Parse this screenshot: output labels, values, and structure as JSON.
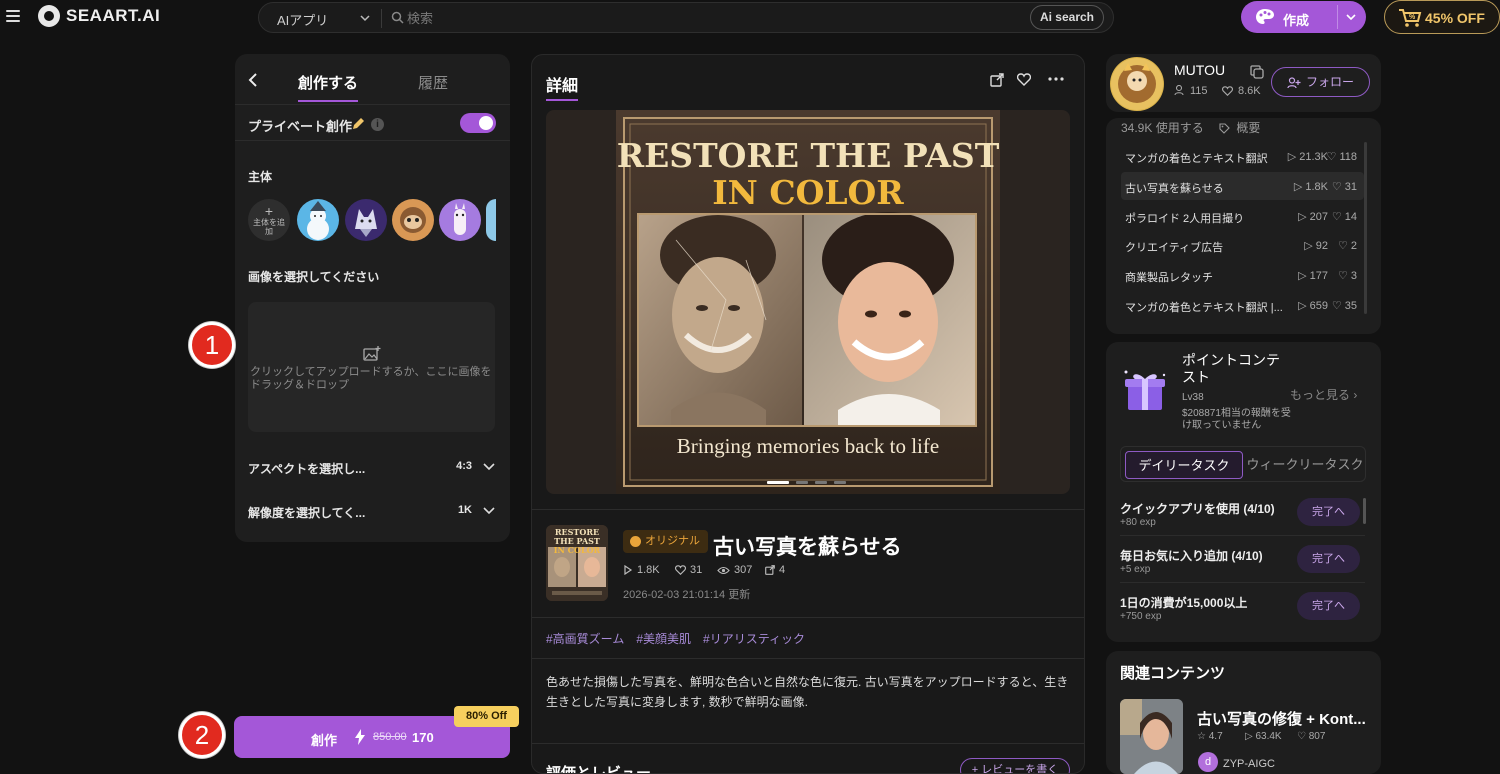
{
  "topbar": {
    "logo_text": "SEAART.AI",
    "search_category": "AIアプリ",
    "search_placeholder": "検索",
    "ai_search_label": "Ai search",
    "create_label": "作成",
    "discount_label": "45% OFF"
  },
  "left_panel": {
    "tab_create": "創作する",
    "tab_history": "履歴",
    "private_label": "プライベート創作",
    "private_enabled": true,
    "subject_title": "主体",
    "add_subject_plus": "+",
    "add_subject_label": "主体を追加",
    "image_title": "画像を選択してください",
    "upload_hint": "クリックしてアップロードするか、ここに画像をドラッグ＆ドロップ",
    "aspect_label": "アスペクトを選択し...",
    "aspect_value": "4:3",
    "resolution_label": "解像度を選択してく...",
    "resolution_value": "1K"
  },
  "generate": {
    "label": "創作",
    "old_price": "850.00",
    "new_price": "170",
    "badge": "80% Off"
  },
  "steps": [
    "1",
    "2"
  ],
  "detail": {
    "heading": "詳細",
    "hero_title_line1": "RESTORE THE PAST",
    "hero_title_line2": "IN COLOR",
    "hero_subtitle": "Bringing memories back to life",
    "thumb_title_line1": "RESTORE THE PAST",
    "thumb_title_line2": "IN COLOR",
    "original_badge": "オリジナル",
    "app_title": "古い写真を蘇らせる",
    "runs": "1.8K",
    "likes": "31",
    "views": "307",
    "shares": "4",
    "updated": "2026-02-03 21:01:14 更新",
    "tags": [
      "#高画質ズーム",
      "#美顔美肌",
      "#リアリスティック"
    ],
    "description": "色あせた損傷した写真を、鮮明な色合いと自然な色に復元. 古い写真をアップロードすると、生き生きとした写真に変身します, 数秒で鮮明な画像.",
    "reviews_title": "評価とレビュー",
    "write_review": "+ レビューを書く"
  },
  "profile": {
    "name": "MUTOU",
    "followers": "115",
    "likes": "8.6K",
    "follow_label": "フォロー",
    "usage": "34.9K 使用する",
    "overview": "概要"
  },
  "app_list": [
    {
      "name": "マンガの着色とテキスト翻訳",
      "runs": "21.3K",
      "likes": "118"
    },
    {
      "name": "古い写真を蘇らせる",
      "runs": "1.8K",
      "likes": "31"
    },
    {
      "name": "ポラロイド 2人用目撮り",
      "runs": "207",
      "likes": "14"
    },
    {
      "name": "クリエイティブ広告",
      "runs": "92",
      "likes": "2"
    },
    {
      "name": "商業製品レタッチ",
      "runs": "177",
      "likes": "3"
    },
    {
      "name": "マンガの着色とテキスト翻訳 |...",
      "runs": "659",
      "likes": "35"
    }
  ],
  "contest": {
    "title": "ポイントコンテスト",
    "more": "もっと見る",
    "level": "Lv38",
    "reward": "$208871相当の報酬を受け取っていません",
    "tab_daily": "デイリータスク",
    "tab_weekly": "ウィークリータスク",
    "tasks": [
      {
        "name": "クイックアプリを使用 (4/10)",
        "exp": "+80 exp",
        "button": "完了へ"
      },
      {
        "name": "毎日お気に入り追加 (4/10)",
        "exp": "+5 exp",
        "button": "完了へ"
      },
      {
        "name": "1日の消費が15,000以上",
        "exp": "+750 exp",
        "button": "完了へ"
      }
    ]
  },
  "related": {
    "title": "関連コンテンツ",
    "item_name": "古い写真の修復 + Kont...",
    "rating": "4.7",
    "runs": "63.4K",
    "likes": "807",
    "author": "ZYP-AIGC",
    "author_initial": "d"
  }
}
